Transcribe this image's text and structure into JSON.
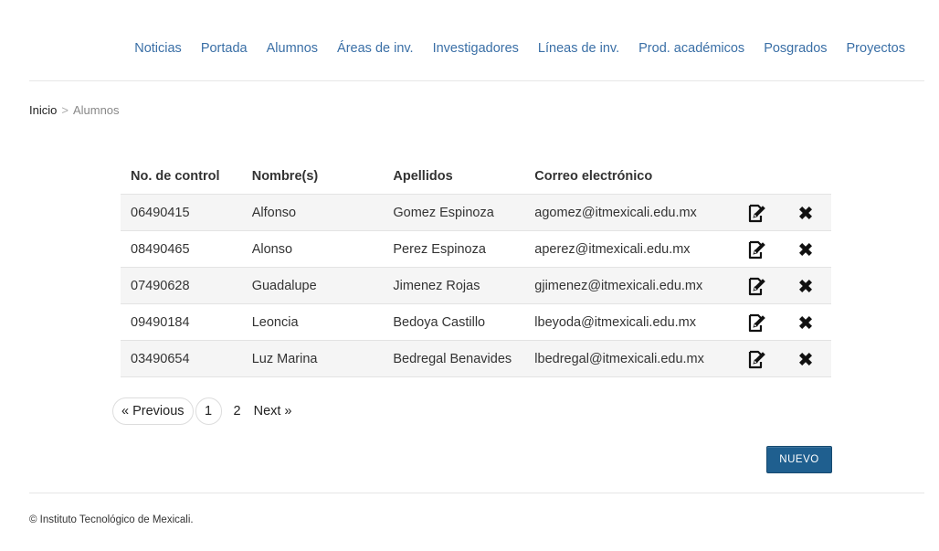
{
  "nav": {
    "items": [
      "Noticias",
      "Portada",
      "Alumnos",
      "Áreas de inv.",
      "Investigadores",
      "Líneas de inv.",
      "Prod. académicos",
      "Posgrados",
      "Proyectos"
    ]
  },
  "breadcrumb": {
    "home": "Inicio",
    "separator": ">",
    "current": "Alumnos"
  },
  "table": {
    "headers": {
      "control": "No. de control",
      "nombre": "Nombre(s)",
      "apellidos": "Apellidos",
      "correo": "Correo electrónico"
    },
    "rows": [
      {
        "control": "06490415",
        "nombre": "Alfonso",
        "apellidos": "Gomez Espinoza",
        "correo": "agomez@itmexicali.edu.mx"
      },
      {
        "control": "08490465",
        "nombre": "Alonso",
        "apellidos": "Perez Espinoza",
        "correo": "aperez@itmexicali.edu.mx"
      },
      {
        "control": "07490628",
        "nombre": "Guadalupe",
        "apellidos": "Jimenez Rojas",
        "correo": "gjimenez@itmexicali.edu.mx"
      },
      {
        "control": "09490184",
        "nombre": "Leoncia",
        "apellidos": "Bedoya Castillo",
        "correo": "lbeyoda@itmexicali.edu.mx"
      },
      {
        "control": "03490654",
        "nombre": "Luz Marina",
        "apellidos": "Bedregal Benavides",
        "correo": "lbedregal@itmexicali.edu.mx"
      }
    ],
    "row_icons": {
      "edit": "edit-icon",
      "delete": "delete-icon"
    }
  },
  "pagination": {
    "previous": "« Previous",
    "pages": [
      "1",
      "2"
    ],
    "current_page": "1",
    "next": "Next »"
  },
  "actions": {
    "new_label": "NUEVO"
  },
  "footer": {
    "text": "© Instituto Tecnológico de Mexicali."
  },
  "colors": {
    "nav_link": "#3a6fa6",
    "button_bg": "#1f5f8f",
    "stripe": "#f5f5f5"
  }
}
